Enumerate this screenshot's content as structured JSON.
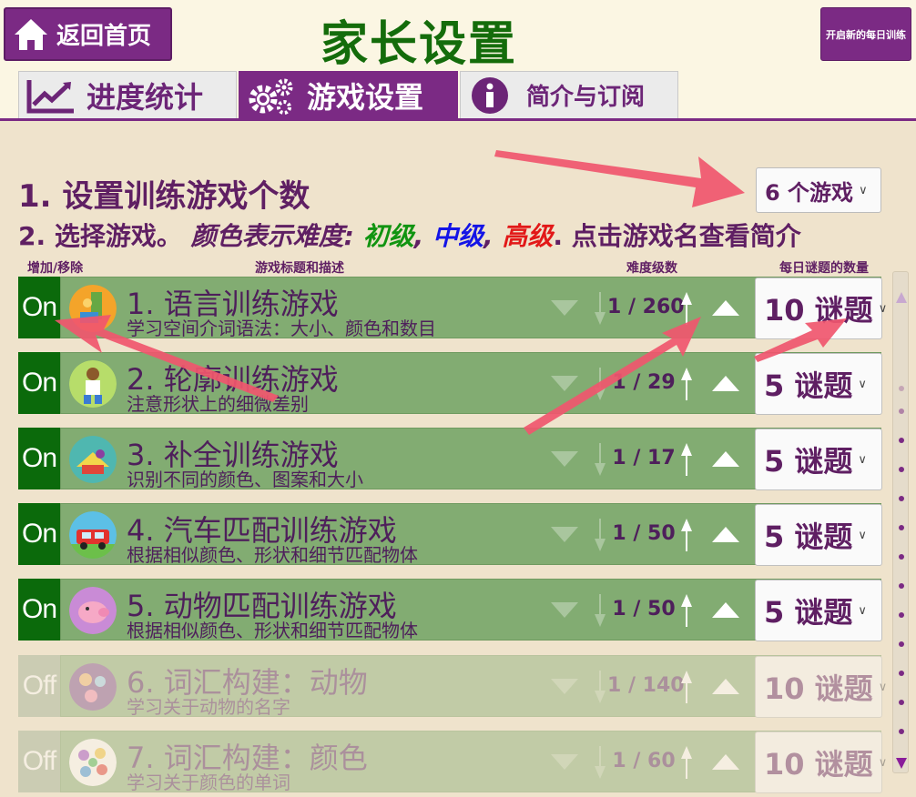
{
  "header": {
    "home_label": "返回首页",
    "title": "家长设置",
    "new_training_label": "开启新的每日训练"
  },
  "tabs": [
    {
      "label": "进度统计",
      "icon": "chart-line-icon",
      "active": false
    },
    {
      "label": "游戏设置",
      "icon": "gears-icon",
      "active": true
    },
    {
      "label": "简介与订阅",
      "icon": "info-icon",
      "active": false
    }
  ],
  "settings": {
    "step1": "1. 设置训练游戏个数",
    "game_count": "6 个游戏",
    "step2_prefix": "2. 选择游戏。",
    "step2_color_note": "颜色表示难度:",
    "level_easy": "初级",
    "level_mid": "中级",
    "level_hard": "高级",
    "step2_suffix": ". 点击游戏名查看简介"
  },
  "columns": {
    "toggle": "增加/移除",
    "title": "游戏标题和描述",
    "level": "难度级数",
    "count": "每日谜题的数量"
  },
  "colors": {
    "accent": "#7b2a84",
    "on": "#0b6a0b",
    "row": "#82ac72",
    "title": "#146c0b"
  },
  "games": [
    {
      "toggle": "On",
      "title": "1. 语言训练游戏",
      "desc": "学习空间介词语法：大小、颜色和数目",
      "level": "1 / 260",
      "count": "10 谜题",
      "icon": "language-game-icon"
    },
    {
      "toggle": "On",
      "title": "2. 轮廓训练游戏",
      "desc": "注意形状上的细微差别",
      "level": "1 / 29",
      "count": "5 谜题",
      "icon": "outline-game-icon"
    },
    {
      "toggle": "On",
      "title": "3. 补全训练游戏",
      "desc": "识别不同的颜色、图案和大小",
      "level": "1 / 17",
      "count": "5 谜题",
      "icon": "completion-game-icon"
    },
    {
      "toggle": "On",
      "title": "4. 汽车匹配训练游戏",
      "desc": "根据相似颜色、形状和细节匹配物体",
      "level": "1 / 50",
      "count": "5 谜题",
      "icon": "car-game-icon"
    },
    {
      "toggle": "On",
      "title": "5. 动物匹配训练游戏",
      "desc": "根据相似颜色、形状和细节匹配物体",
      "level": "1 / 50",
      "count": "5 谜题",
      "icon": "animal-game-icon"
    },
    {
      "toggle": "Off",
      "title": "6. 词汇构建：动物",
      "desc": "学习关于动物的名字",
      "level": "1 / 140",
      "count": "10 谜题",
      "icon": "animals-vocab-icon"
    },
    {
      "toggle": "Off",
      "title": "7. 词汇构建：颜色",
      "desc": "学习关于颜色的单词",
      "level": "1 / 60",
      "count": "10 谜题",
      "icon": "colors-vocab-icon"
    }
  ]
}
